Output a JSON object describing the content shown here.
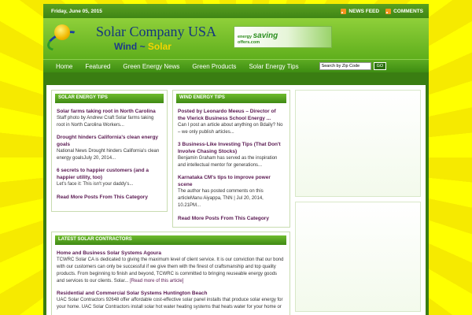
{
  "topbar": {
    "date": "Friday, June 05, 2015",
    "news_feed": "NEWS FEED",
    "comments": "COMMENTS"
  },
  "header": {
    "title": "Solar Company USA",
    "sub_wind": "Wind",
    "sub_sep": "~",
    "sub_solar": "Solar",
    "banner_small": "energy",
    "banner_big": "saving",
    "banner_site": "offers.com"
  },
  "nav": {
    "items": [
      "Home",
      "Featured",
      "Green Energy News",
      "Green Products",
      "Solar Energy Tips"
    ],
    "search_placeholder": "Search by Zip Code",
    "go": "GO"
  },
  "solar_tips": {
    "title": "SOLAR ENERGY TIPS",
    "posts": [
      {
        "title": "Solar farms taking root in North Carolina",
        "excerpt": "Staff photo by Andrew Craft Solar farms taking root in North Carolina Workers..."
      },
      {
        "title": "Drought hinders California's clean energy goals",
        "excerpt": "National News Drought hinders California's clean energy goalsJuly 20, 2014..."
      },
      {
        "title": "6 secrets to happier customers (and a happier utility, too)",
        "excerpt": "Let's face it: This isn't your daddy's..."
      }
    ],
    "more": "Read More Posts From This Category"
  },
  "wind_tips": {
    "title": "WIND ENERGY TIPS",
    "posts": [
      {
        "title": "Posted by Leonardo Meeus – Director of the Vlerick Business School Energy ...",
        "excerpt": "Can I post an article about anything on Bdaily? No – we only publish articles..."
      },
      {
        "title": "3 Business-Like Investing Tips (That Don't Involve Chasing Stocks)",
        "excerpt": "Benjamin Graham has served as the inspiration and intellectual mentor for generations..."
      },
      {
        "title": "Karnataka CM's tips to improve power scene",
        "excerpt": "The author has posted comments on this articleManu Aiyappa, TNN | Jul 20, 2014, 10.21PM..."
      }
    ],
    "more": "Read More Posts From This Category"
  },
  "contractors": {
    "title": "LATEST SOLAR CONTRACTORS",
    "posts": [
      {
        "title": "Home and Business Solar Systems Agoura",
        "excerpt": "TCWRC Solar CA is dedicated to giving the maximum level of client service. It is our conviction that our bond with our customers can only be successful if we give them with the finest of craftsmanship and top quality products. From beginning to finish and beyond, TCWRC is committed to bringing reuseable energy goods and services to our clients. Solar...",
        "link": "[Read more of this article]"
      },
      {
        "title": "Residential and Commercial Solar Systems Huntington Beach",
        "excerpt": "UAC Solar Contractors 92648 offer affordable cost-effective solar panel installs that produce solar energy for your home. UAC Solar Contractors install solar hot water heating systems that heats water for your home or"
      }
    ]
  }
}
